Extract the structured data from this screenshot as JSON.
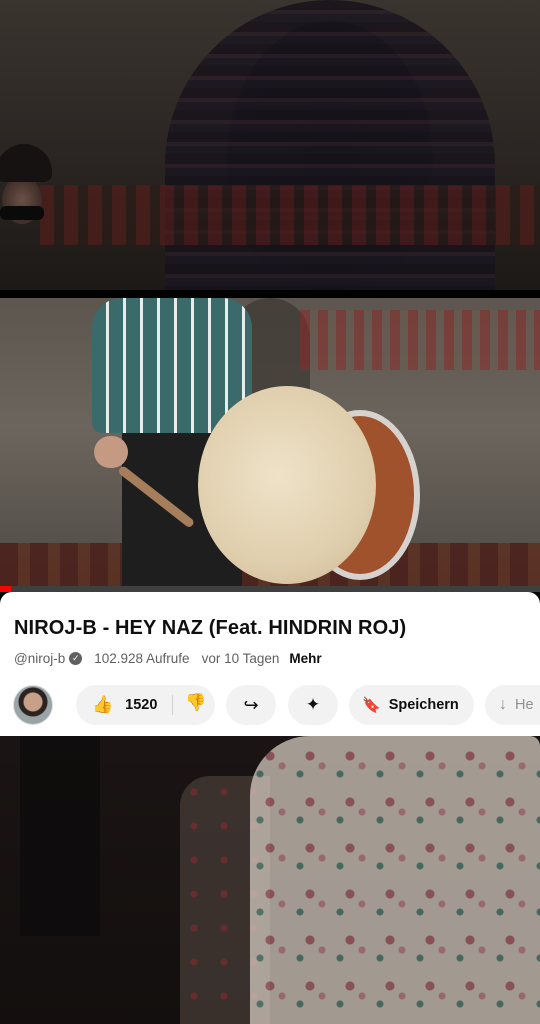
{
  "video": {
    "progress_fraction": 0.02
  },
  "details": {
    "title": "NIROJ-B - HEY NAZ (Feat. HINDRIN ROJ)",
    "channel_handle": "@niroj-b",
    "verified_mark": "✓",
    "views": "102.928 Aufrufe",
    "uploaded": "vor 10 Tagen",
    "more_label": "Mehr"
  },
  "actions": {
    "like_icon": "👍",
    "like_count": "1520",
    "dislike_icon": "👎",
    "share_icon": "↪",
    "remix_icon": "✦",
    "save_icon": "🔖",
    "save_label": "Speichern",
    "download_icon": "↓",
    "download_label": "He"
  },
  "colors": {
    "accent_progress": "#ff0000",
    "panel_bg": "#ffffff",
    "pill_bg": "#f2f2f2"
  }
}
